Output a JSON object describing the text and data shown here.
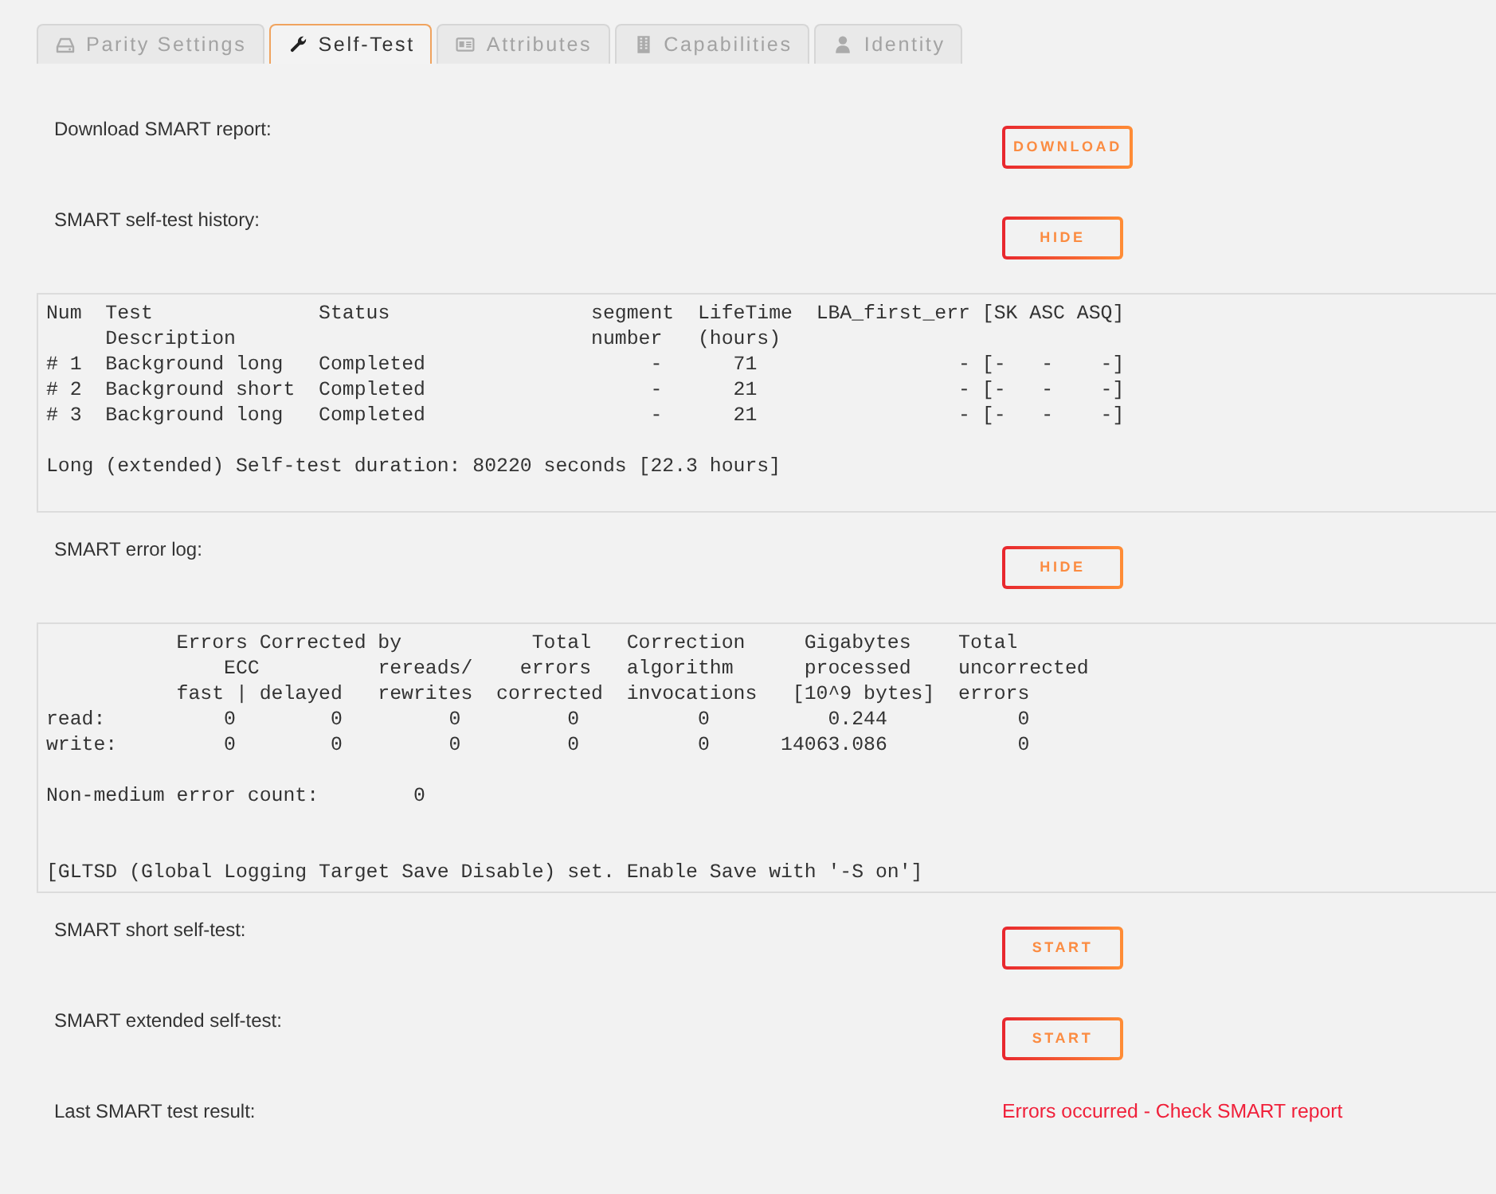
{
  "tabs": [
    {
      "label": "Parity Settings",
      "selected": false
    },
    {
      "label": "Self-Test",
      "selected": true
    },
    {
      "label": "Attributes",
      "selected": false
    },
    {
      "label": "Capabilities",
      "selected": false
    },
    {
      "label": "Identity",
      "selected": false
    }
  ],
  "sections": [
    {
      "kind": "action",
      "label": "Download SMART report:",
      "button": "DOWNLOAD"
    },
    {
      "kind": "action",
      "label": "SMART self-test history:",
      "button": "HIDE"
    },
    {
      "kind": "output",
      "text": "Num  Test              Status                 segment  LifeTime  LBA_first_err [SK ASC ASQ]\n     Description                              number   (hours)\n# 1  Background long   Completed                   -      71                 - [-   -    -]\n# 2  Background short  Completed                   -      21                 - [-   -    -]\n# 3  Background long   Completed                   -      21                 - [-   -    -]\n\nLong (extended) Self-test duration: 80220 seconds [22.3 hours]\n"
    },
    {
      "kind": "action",
      "label": "SMART error log:",
      "button": "HIDE"
    },
    {
      "kind": "output",
      "text": "           Errors Corrected by           Total   Correction     Gigabytes    Total\n               ECC          rereads/    errors   algorithm      processed    uncorrected\n           fast | delayed   rewrites  corrected  invocations   [10^9 bytes]  errors\nread:          0        0         0         0          0          0.244           0\nwrite:         0        0         0         0          0      14063.086           0\n\nNon-medium error count:        0\n\n\n[GLTSD (Global Logging Target Save Disable) set. Enable Save with '-S on']"
    },
    {
      "kind": "action",
      "label": "SMART short self-test:",
      "button": "START"
    },
    {
      "kind": "action",
      "label": "SMART extended self-test:",
      "button": "START"
    },
    {
      "kind": "result",
      "label": "Last SMART test result:",
      "value": "Errors occurred - Check SMART report",
      "error": true
    }
  ]
}
